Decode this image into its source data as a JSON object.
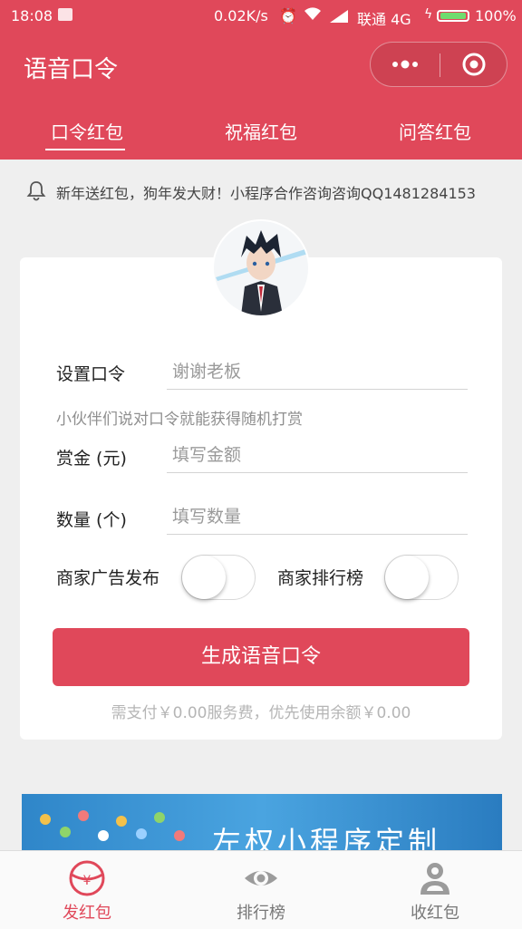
{
  "status_bar": {
    "time": "18:08",
    "network_speed": "0.02K/s",
    "carrier": "联通 4G",
    "battery_percent": "100%",
    "battery_level": 1.0,
    "icons": [
      "sim-icon",
      "alarm-icon",
      "wifi-icon",
      "signal-icon",
      "charging-icon",
      "battery-icon"
    ]
  },
  "nav": {
    "title": "语音口令"
  },
  "tabs": [
    {
      "label": "口令红包",
      "active": true
    },
    {
      "label": "祝福红包",
      "active": false
    },
    {
      "label": "问答红包",
      "active": false
    }
  ],
  "notice": {
    "text": "新年送红包，狗年发大财！小程序合作咨询咨询QQ1481284153"
  },
  "form": {
    "password_label": "设置口令",
    "password_placeholder": "谢谢老板",
    "hint": "小伙伴们说对口令就能获得随机打赏",
    "amount_label": "赏金 (元)",
    "amount_placeholder": "填写金额",
    "quantity_label": "数量 (个)",
    "quantity_placeholder": "填写数量",
    "ad_toggle_label": "商家广告发布",
    "ad_toggle_on": false,
    "rank_toggle_label": "商家排行榜",
    "rank_toggle_on": false,
    "submit_label": "生成语音口令",
    "pay_note": "需支付￥0.00服务费，优先使用余额￥0.00"
  },
  "banner": {
    "text": "左权小程序定制"
  },
  "tabbar": [
    {
      "label": "发红包",
      "icon": "red-packet-icon",
      "active": true
    },
    {
      "label": "排行榜",
      "icon": "eye-icon",
      "active": false
    },
    {
      "label": "收红包",
      "icon": "user-icon",
      "active": false
    }
  ],
  "colors": {
    "brand": "#e0485a",
    "inactive": "#9b9b9b",
    "text": "#222222"
  }
}
